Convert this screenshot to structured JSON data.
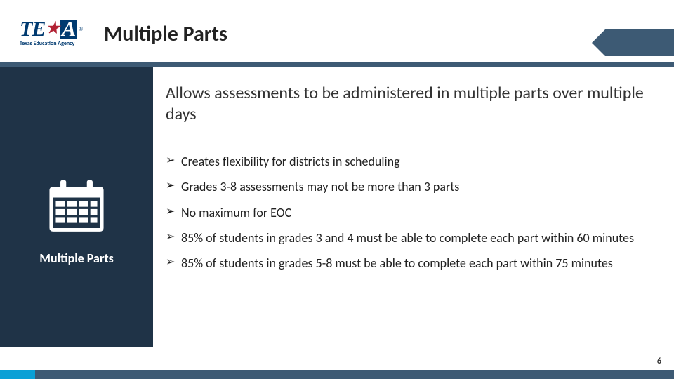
{
  "logo": {
    "text": "TEA",
    "sub": "Texas Education Agency"
  },
  "title": "Multiple Parts",
  "sidebar": {
    "label": "Multiple Parts"
  },
  "subhead": "Allows assessments to be administered in multiple parts over multiple days",
  "bullets": [
    "Creates flexibility for districts in scheduling",
    "Grades 3-8 assessments may not be more than 3 parts",
    "No maximum for EOC",
    "85% of students in grades 3 and 4 must be able to complete each part within 60 minutes",
    "85% of students in grades 5-8 must be able to complete each part within 75 minutes"
  ],
  "page_number": "6",
  "colors": {
    "brand_navy": "#003a70",
    "bar": "#3d5a74",
    "sidebar": "#1f3347",
    "accent": "#0aa0d6"
  }
}
